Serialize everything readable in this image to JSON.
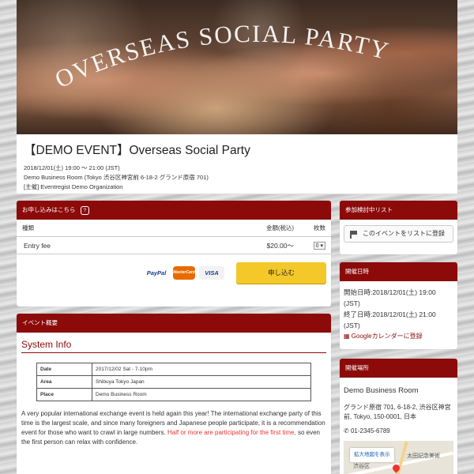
{
  "hero": {
    "banner_text": "OVERSEAS SOCIAL PARTY"
  },
  "event": {
    "title": "【DEMO EVENT】Overseas Social Party",
    "datetime": "2018/12/01(土) 19:00 ～ 21:00 (JST)",
    "venue_line": "Demo Business Room (Tokyo 渋谷区神宮前 6-18-2 グランド原宿 701)",
    "organizer": "[主催] Eventregist Demo Organization"
  },
  "signup": {
    "header": "お申し込みはこちら",
    "badge": "?",
    "col_type": "種類",
    "col_price": "金額(税込)",
    "col_qty": "枚数",
    "ticket_name": "Entry fee",
    "ticket_price": "$20.00～",
    "ticket_qty": "0",
    "cards": [
      "PayPal",
      "MasterCard",
      "VISA"
    ],
    "apply_label": "申し込む"
  },
  "overview": {
    "header": "イベント概要",
    "section_title": "System Info",
    "rows": [
      {
        "key": "Date",
        "value": "2017/12/02 Sat - 7-10pm"
      },
      {
        "key": "Area",
        "value": "Shibuya Tokyo Japan"
      },
      {
        "key": "Place",
        "value": "Demo Business Room"
      }
    ],
    "desc": "A very popular international exchange event is held again this year! The international exchange party of this time is the largest scale, and since many foreigners and Japanese people participate, it is a recommendation event for those who want to crawl in large numbers.",
    "desc_red": "Half or more are participating for the first time,",
    "desc_tail": " so even the first person can relax with confidence."
  },
  "watchlist": {
    "header": "参加検討中リスト",
    "button": "このイベントをリストに登録"
  },
  "schedule": {
    "header": "開催日時",
    "start": "開始日時:2018/12/01(土) 19:00 (JST)",
    "end": "終了日時:2018/12/01(土) 21:00 (JST)",
    "gcal": "Googleカレンダーに登録"
  },
  "place": {
    "header": "開催場所",
    "name": "Demo Business Room",
    "address": "グランド原宿 701, 6-18-2, 渋谷区神宮前, Tokyo, 150-0001, 日本",
    "phone": "01-2345-6789",
    "map_button": "拡大地図を表示",
    "map_label1": "渋谷区",
    "map_label2": "太田記念美術"
  }
}
